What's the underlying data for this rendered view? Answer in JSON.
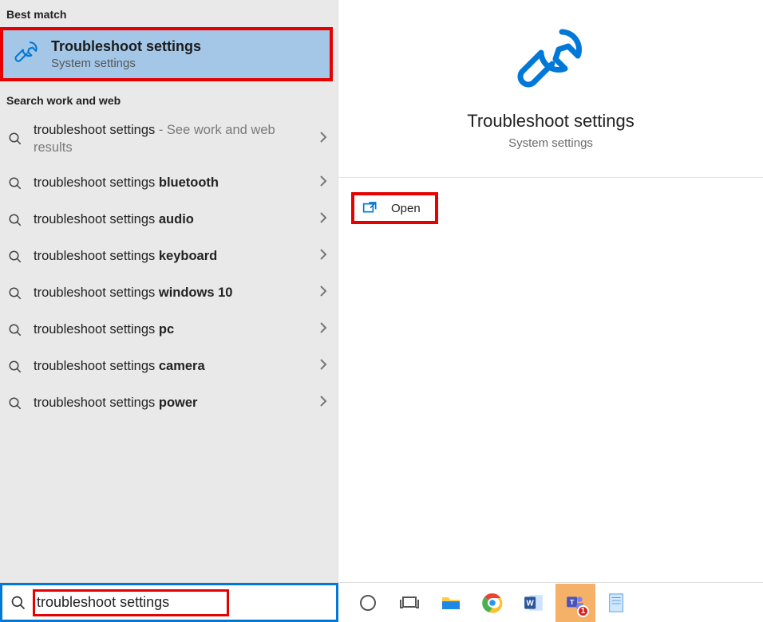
{
  "left": {
    "best_match_header": "Best match",
    "best_match": {
      "title": "Troubleshoot settings",
      "subtitle": "System settings"
    },
    "search_header": "Search work and web",
    "suggestions": [
      {
        "prefix": "troubleshoot settings",
        "suffix": " - See work and web results",
        "bold": ""
      },
      {
        "prefix": "troubleshoot settings ",
        "suffix": "",
        "bold": "bluetooth"
      },
      {
        "prefix": "troubleshoot settings ",
        "suffix": "",
        "bold": "audio"
      },
      {
        "prefix": "troubleshoot settings ",
        "suffix": "",
        "bold": "keyboard"
      },
      {
        "prefix": "troubleshoot settings ",
        "suffix": "",
        "bold": "windows 10"
      },
      {
        "prefix": "troubleshoot settings ",
        "suffix": "",
        "bold": "pc"
      },
      {
        "prefix": "troubleshoot settings ",
        "suffix": "",
        "bold": "camera"
      },
      {
        "prefix": "troubleshoot settings ",
        "suffix": "",
        "bold": "power"
      }
    ]
  },
  "right": {
    "title": "Troubleshoot settings",
    "subtitle": "System settings",
    "open_label": "Open"
  },
  "taskbar": {
    "search_value": "troubleshoot settings",
    "teams_badge": "1"
  },
  "colors": {
    "accent": "#0078d7",
    "highlight_box": "#e60000",
    "selected_bg": "#a4c7e8"
  }
}
